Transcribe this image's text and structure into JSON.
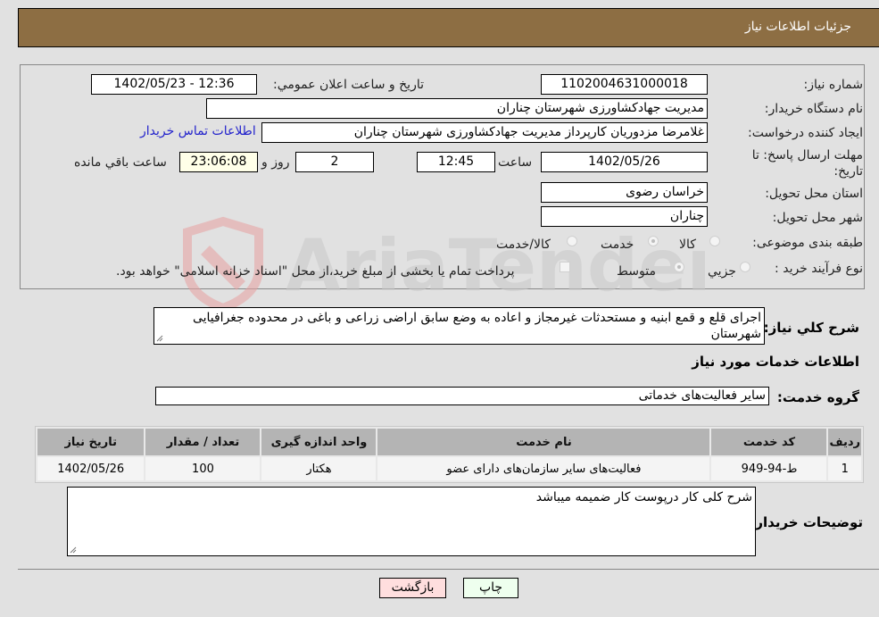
{
  "header": {
    "title": "جزئیات اطلاعات نیاز"
  },
  "form": {
    "need_number": {
      "label": "شماره نیاز:",
      "value": "1102004631000018"
    },
    "announce_datetime": {
      "label": "تاریخ و ساعت اعلان عمومي:",
      "value": "1402/05/23 - 12:36"
    },
    "buyer_org": {
      "label": "نام دستگاه خریدار:",
      "value": "مدیریت جهادکشاورزی شهرستان چناران"
    },
    "requester": {
      "label": "ایجاد کننده درخواست:",
      "value": "غلامرضا مزدوریان کارپرداز مدیریت جهادکشاورزی شهرستان چناران"
    },
    "contact_link": "اطلاعات تماس خریدار",
    "deadline": {
      "label": "مهلت ارسال پاسخ: تا تاریخ:",
      "date": "1402/05/26",
      "time_label": "ساعت",
      "time": "12:45",
      "days": "2",
      "days_label": "روز و",
      "remaining": "23:06:08",
      "remaining_label": "ساعت باقي مانده"
    },
    "province": {
      "label": "استان محل تحویل:",
      "value": "خراسان رضوی"
    },
    "city": {
      "label": "شهر محل تحویل:",
      "value": "چناران"
    },
    "category": {
      "label": "طبقه بندی موضوعی:",
      "options": [
        "کالا",
        "خدمت",
        "کالا/خدمت"
      ],
      "selected": "خدمت"
    },
    "purchase_type": {
      "label": "نوع فرآیند خرید :",
      "options": [
        "جزیي",
        "متوسط"
      ],
      "selected": "متوسط",
      "treasury_note": "پرداخت تمام یا بخشی از مبلغ خرید،از محل \"اسناد خزانه اسلامی\" خواهد بود."
    }
  },
  "description": {
    "label": "شرح کلي نیاز:",
    "value": "اجرای قلع و قمع ابنیه و مستحدثات غیرمجاز و اعاده به وضع سابق اراضی زراعی و باغی در محدوده جغرافیایی شهرستان"
  },
  "services_section": {
    "title": "اطلاعات خدمات مورد نیاز",
    "group_label": "گروه خدمت:",
    "group_value": "سایر فعالیت‌های خدماتی"
  },
  "table": {
    "headers": [
      "ردیف",
      "کد خدمت",
      "نام خدمت",
      "واحد اندازه گیری",
      "تعداد / مقدار",
      "تاریخ نیاز"
    ],
    "rows": [
      [
        "1",
        "ط-94-949",
        "فعالیت‌های سایر سازمان‌های دارای عضو",
        "هکتار",
        "100",
        "1402/05/26"
      ]
    ]
  },
  "buyer_notes": {
    "label": "توضیحات خریدار:",
    "value": "شرح کلی کار درپوست کار ضمیمه میباشد"
  },
  "buttons": {
    "print": "چاپ",
    "back": "بازگشت"
  },
  "colors": {
    "header_bg": "#8d6e43",
    "print_bg": "#eeffee",
    "back_bg": "#ffdede",
    "link": "#2222cc"
  }
}
